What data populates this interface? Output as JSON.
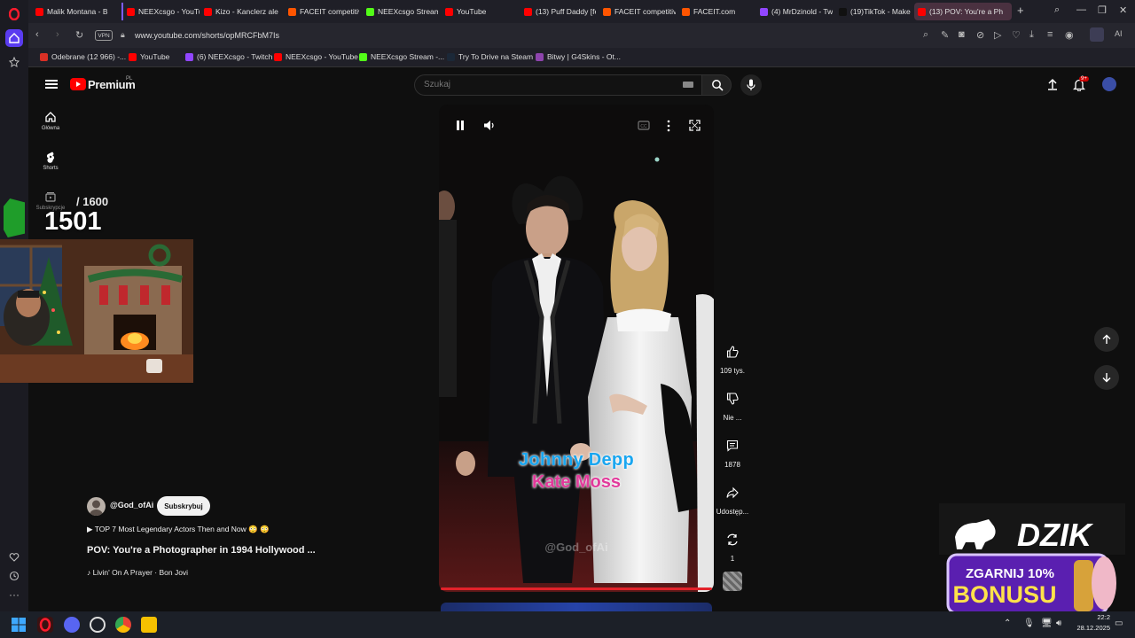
{
  "browser": {
    "tabs": [
      {
        "label": "Malik Montana - Bi",
        "color": "#ff0000"
      },
      {
        "label": "NEEXcsgo - YouTub",
        "color": "#ff0000"
      },
      {
        "label": "Kizo - Kanclerz ale",
        "color": "#ff0000"
      },
      {
        "label": "FACEIT competitive",
        "color": "#ff5500"
      },
      {
        "label": "NEEXcsgo Stream -",
        "color": "#53fc18"
      },
      {
        "label": "YouTube",
        "color": "#ff0000"
      },
      {
        "label": "(13) Puff Daddy [fe",
        "color": "#ff0000"
      },
      {
        "label": "FACEIT competitive",
        "color": "#ff5500"
      },
      {
        "label": "FACEIT.com",
        "color": "#ff5500"
      },
      {
        "label": "(4) MrDzinold - Tw",
        "color": "#9146ff"
      },
      {
        "label": "(19)TikTok - Make Y",
        "color": "#111111"
      },
      {
        "label": "(13) POV: You're a Ph",
        "color": "#ff0000"
      }
    ],
    "url": "www.youtube.com/shorts/opMRCFbM7Is",
    "vpn_label": "VPN",
    "bookmarks": [
      {
        "label": "Odebrane (12 966) -...",
        "color": "#d93025"
      },
      {
        "label": "YouTube",
        "color": "#ff0000"
      },
      {
        "label": "(6) NEEXcsgo - Twitch",
        "color": "#9146ff"
      },
      {
        "label": "NEEXcsgo - YouTube",
        "color": "#ff0000"
      },
      {
        "label": "NEEXcsgo Stream -...",
        "color": "#53fc18"
      },
      {
        "label": "Try To Drive na Steam",
        "color": "#1b2838"
      },
      {
        "label": "Bitwy | G4Skins - Ot...",
        "color": "#8e44ad"
      }
    ]
  },
  "yt_header": {
    "brand": "Premium",
    "country": "PL",
    "search_placeholder": "Szukaj",
    "notif_count": "9+"
  },
  "guide": [
    {
      "label": "Główna",
      "icon": "home-icon"
    },
    {
      "label": "Shorts",
      "icon": "shorts-icon"
    },
    {
      "label": "Subskrypcje",
      "icon": "subscriptions-icon"
    }
  ],
  "overlay": {
    "counter_value": "1501",
    "counter_total": "/ 1600",
    "ad_brand": "DZIK",
    "ad_line1": "ZGARNIJ 10%",
    "ad_line2": "BONUSU"
  },
  "video": {
    "caption_1": "Johnny Depp",
    "caption_2": "Kate Moss",
    "watermark": "@God_ofAi",
    "progress": 1.0
  },
  "actions": {
    "likes": "109 tys.",
    "dislike": "Nie ...",
    "comments": "1878",
    "share": "Udostęp...",
    "remix": "1"
  },
  "channel": {
    "handle": "@God_ofAi",
    "subscribe": "Subskrybuj",
    "playlist": "TOP 7 Most Legendary Actors Then and Now 😳 😳",
    "title": "POV: You're a Photographer in 1994 Hollywood ...",
    "music": "Livin' On A Prayer · Bon Jovi"
  },
  "taskbar": {
    "time": "22:2",
    "date": "28.12.2025"
  }
}
